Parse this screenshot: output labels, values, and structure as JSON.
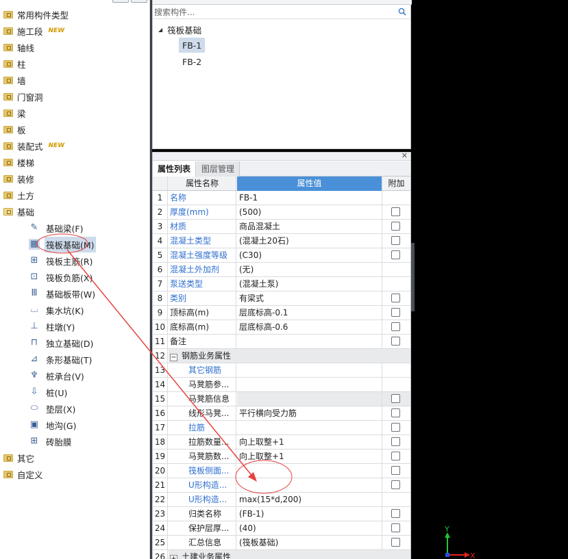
{
  "colors": {
    "accent": "#4a90d9",
    "link_blue": "#2f6fd0",
    "annotation_red": "#e8413c",
    "selection": "#cddbeb"
  },
  "tree": {
    "categories": [
      {
        "label": "常用构件类型",
        "icon": "folder-icon"
      },
      {
        "label": "施工段",
        "badge": "NEW",
        "icon": "folder-icon"
      },
      {
        "label": "轴线",
        "icon": "folder-icon"
      },
      {
        "label": "柱",
        "icon": "folder-icon"
      },
      {
        "label": "墙",
        "icon": "folder-icon"
      },
      {
        "label": "门窗洞",
        "icon": "folder-icon"
      },
      {
        "label": "梁",
        "icon": "folder-icon"
      },
      {
        "label": "板",
        "icon": "folder-icon"
      },
      {
        "label": "装配式",
        "badge": "NEW",
        "icon": "folder-icon"
      },
      {
        "label": "楼梯",
        "icon": "folder-icon"
      },
      {
        "label": "装修",
        "icon": "folder-icon"
      },
      {
        "label": "土方",
        "icon": "folder-icon"
      },
      {
        "label": "基础",
        "icon": "folder-open-icon"
      }
    ],
    "foundation_items": [
      {
        "label": "基础梁(F)",
        "icon": "foundation-beam-icon"
      },
      {
        "label": "筏板基础(M)",
        "icon": "raft-foundation-icon",
        "selected": true
      },
      {
        "label": "筏板主筋(R)",
        "icon": "raft-main-rebar-icon"
      },
      {
        "label": "筏板负筋(X)",
        "icon": "raft-negative-rebar-icon"
      },
      {
        "label": "基础板带(W)",
        "icon": "foundation-strip-icon"
      },
      {
        "label": "集水坑(K)",
        "icon": "sump-pit-icon"
      },
      {
        "label": "柱墩(Y)",
        "icon": "column-pier-icon"
      },
      {
        "label": "独立基础(D)",
        "icon": "isolated-footing-icon"
      },
      {
        "label": "条形基础(T)",
        "icon": "strip-footing-icon"
      },
      {
        "label": "桩承台(V)",
        "icon": "pile-cap-icon"
      },
      {
        "label": "桩(U)",
        "icon": "pile-icon"
      },
      {
        "label": "垫层(X)",
        "icon": "cushion-layer-icon"
      },
      {
        "label": "地沟(G)",
        "icon": "trench-icon"
      },
      {
        "label": "砖胎膜",
        "icon": "brick-mold-icon"
      }
    ],
    "bottom_categories": [
      {
        "label": "其它",
        "icon": "folder-icon"
      },
      {
        "label": "自定义",
        "icon": "folder-icon"
      }
    ]
  },
  "components": {
    "search_placeholder": "搜索构件...",
    "group_label": "筏板基础",
    "items": [
      "FB-1",
      "FB-2"
    ]
  },
  "properties": {
    "tabs": [
      "属性列表",
      "图层管理"
    ],
    "headers": {
      "name": "属性名称",
      "value": "属性值",
      "extra": "附加"
    },
    "rows": [
      {
        "num": "1",
        "name": "名称",
        "value": "FB-1",
        "blue": true,
        "cb": false
      },
      {
        "num": "2",
        "name": "厚度(mm)",
        "value": "(500)",
        "blue": true,
        "cb": true
      },
      {
        "num": "3",
        "name": "材质",
        "value": "商品混凝土",
        "blue": true,
        "cb": true
      },
      {
        "num": "4",
        "name": "混凝土类型",
        "value": "(混凝土20石)",
        "blue": true,
        "cb": true
      },
      {
        "num": "5",
        "name": "混凝土强度等级",
        "value": "(C30)",
        "blue": true,
        "cb": true
      },
      {
        "num": "6",
        "name": "混凝土外加剂",
        "value": "(无)",
        "blue": true,
        "cb": false
      },
      {
        "num": "7",
        "name": "泵送类型",
        "value": "(混凝土泵)",
        "blue": true,
        "cb": false
      },
      {
        "num": "8",
        "name": "类别",
        "value": "有梁式",
        "blue": true,
        "cb": true
      },
      {
        "num": "9",
        "name": "顶标高(m)",
        "value": "层底标高-0.1",
        "blue": false,
        "cb": true
      },
      {
        "num": "10",
        "name": "底标高(m)",
        "value": "层底标高-0.6",
        "blue": false,
        "cb": true
      },
      {
        "num": "11",
        "name": "备注",
        "value": "",
        "blue": false,
        "cb": true
      },
      {
        "num": "12",
        "name": "钢筋业务属性",
        "group": true,
        "expander": "−"
      },
      {
        "num": "13",
        "name": "其它钢筋",
        "value": "",
        "blue": true,
        "indent": true,
        "cb": false
      },
      {
        "num": "14",
        "name": "马凳筋参...",
        "value": "",
        "blue": false,
        "indent": true,
        "cb": false
      },
      {
        "num": "15",
        "name": "马凳筋信息",
        "value": "",
        "blue": false,
        "indent": true,
        "gray": true,
        "cb": true
      },
      {
        "num": "16",
        "name": "线形马凳...",
        "value": "平行横向受力筋",
        "blue": false,
        "indent": true,
        "cb": true
      },
      {
        "num": "17",
        "name": "拉筋",
        "value": "",
        "blue": true,
        "indent": true,
        "cb": true
      },
      {
        "num": "18",
        "name": "拉筋数量...",
        "value": "向上取整+1",
        "blue": false,
        "indent": true,
        "cb": true
      },
      {
        "num": "19",
        "name": "马凳筋数...",
        "value": "向上取整+1",
        "blue": false,
        "indent": true,
        "cb": true
      },
      {
        "num": "20",
        "name": "筏板侧面...",
        "value": "",
        "blue": true,
        "indent": true,
        "cb": true
      },
      {
        "num": "21",
        "name": "U形构造...",
        "value": "",
        "blue": true,
        "indent": true,
        "cb": true
      },
      {
        "num": "22",
        "name": "U形构造...",
        "value": "max(15*d,200)",
        "blue": true,
        "indent": true,
        "cb": false
      },
      {
        "num": "23",
        "name": "归类名称",
        "value": "(FB-1)",
        "blue": false,
        "indent": true,
        "cb": true
      },
      {
        "num": "24",
        "name": "保护层厚...",
        "value": "(40)",
        "blue": false,
        "indent": true,
        "cb": true
      },
      {
        "num": "25",
        "name": "汇总信息",
        "value": "(筏板基础)",
        "blue": false,
        "indent": true,
        "cb": true
      },
      {
        "num": "26",
        "name": "土建业务属性",
        "group": true,
        "expander": "+"
      }
    ]
  },
  "axis": {
    "y_label": "Y",
    "x_label": "X"
  }
}
